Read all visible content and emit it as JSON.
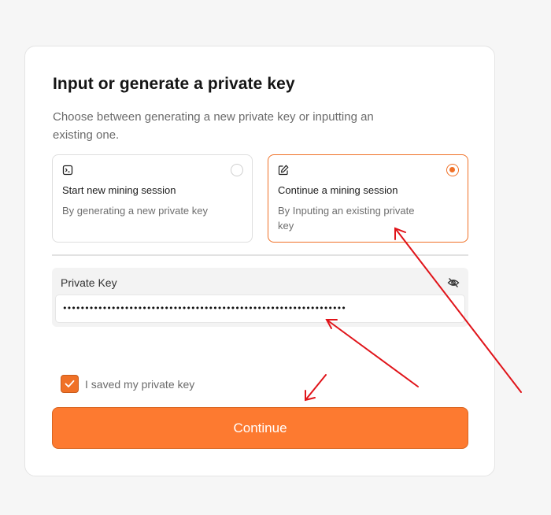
{
  "card": {
    "title": "Input or generate a private key",
    "subtitle": "Choose between generating a new private key or inputting an existing one."
  },
  "options": [
    {
      "title": "Start new mining session",
      "description": "By generating a new private key",
      "icon": "terminal-icon",
      "selected": false
    },
    {
      "title": "Continue a mining session",
      "description": "By Inputing an existing private key",
      "icon": "edit-icon",
      "selected": true
    }
  ],
  "private_key": {
    "label": "Private Key",
    "masked_value": "••••••••••••••••••••••••••••••••••••••••••••••••••••••••••••••••",
    "visibility_icon": "eye-off-icon"
  },
  "confirm": {
    "label": "I saved my private key",
    "checked": true
  },
  "continue_label": "Continue",
  "colors": {
    "accent": "#fd7a30",
    "accent_border": "#f07127",
    "annotation_arrow": "#e0141a"
  }
}
